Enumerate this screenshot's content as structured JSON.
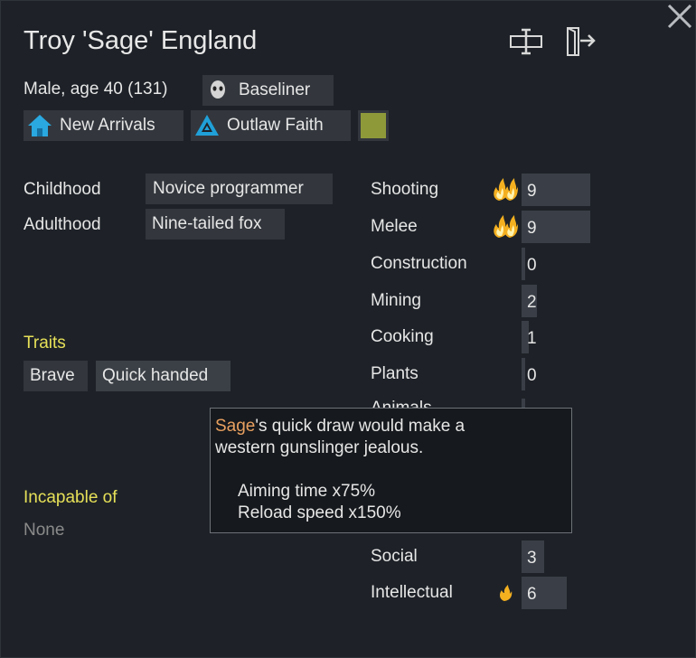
{
  "pawn": {
    "name": "Troy 'Sage' England",
    "summary": "Male, age 40 (131)",
    "xenotype": "Baseliner",
    "faction": "New Arrivals",
    "ideology": "Outlaw Faith",
    "favorite_color": "#8e9a3a"
  },
  "backstory": {
    "childhood_label": "Childhood",
    "childhood_value": "Novice programmer",
    "adulthood_label": "Adulthood",
    "adulthood_value": "Nine-tailed fox"
  },
  "traits": {
    "heading": "Traits",
    "items": [
      "Brave",
      "Quick handed"
    ]
  },
  "incapable": {
    "heading": "Incapable of",
    "value": "None"
  },
  "skills": [
    {
      "name": "Shooting",
      "level": "9",
      "passion": "major"
    },
    {
      "name": "Melee",
      "level": "9",
      "passion": "major"
    },
    {
      "name": "Construction",
      "level": "0",
      "passion": "none"
    },
    {
      "name": "Mining",
      "level": "2",
      "passion": "none"
    },
    {
      "name": "Cooking",
      "level": "1",
      "passion": "none"
    },
    {
      "name": "Plants",
      "level": "0",
      "passion": "none"
    },
    {
      "name": "Social",
      "level": "3",
      "passion": "none"
    },
    {
      "name": "Intellectual",
      "level": "6",
      "passion": "minor"
    }
  ],
  "tooltip": {
    "name": "Sage",
    "text_rest": "'s quick draw would make a",
    "line2": "western gunslinger jealous.",
    "stat1": "Aiming time x75%",
    "stat2": "Reload speed x150%"
  },
  "icons": {
    "close": "close-icon",
    "rename": "rename-icon",
    "banish": "exit-door-icon",
    "xenotype": "skull-face-icon",
    "faction": "house-icon",
    "ideology": "triangle-ideo-icon"
  }
}
